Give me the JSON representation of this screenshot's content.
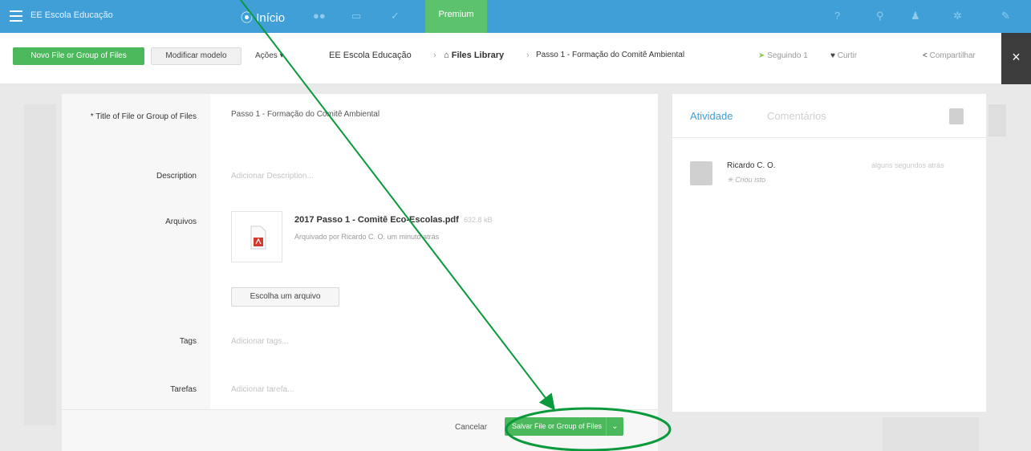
{
  "topbar": {
    "brand": "EE Escola Educação",
    "home": "Início",
    "premium": "Premium",
    "icons": [
      "users-icon",
      "calendar-icon",
      "tasks-icon",
      "help-icon",
      "search-icon",
      "user-icon",
      "add-user-icon",
      "tools-icon"
    ]
  },
  "actionbar": {
    "new_button": "Novo File or Group of Files",
    "modify_button": "Modificar modelo",
    "actions": "Ações",
    "breadcrumb": [
      "EE Escola Educação",
      "Files Library",
      "Passo 1 - Formação do Comitê Ambiental"
    ],
    "follow": "Seguindo",
    "follow_count": "1",
    "like": "Curtir",
    "share": "Compartilhar"
  },
  "form": {
    "title_label": "* Title of File or Group of Files",
    "title_value": "Passo 1 - Formação do Comitê Ambiental",
    "description_label": "Description",
    "description_placeholder": "Adicionar Description...",
    "files_label": "Arquivos",
    "file_name": "2017 Passo 1 - Comitê Eco-Escolas.pdf",
    "file_size": "632.8 kB",
    "file_meta": "Arquivado por Ricardo C. O. um minuto atrás",
    "choose_file": "Escolha um arquivo",
    "tags_label": "Tags",
    "tags_placeholder": "Adicionar tags...",
    "tasks_label": "Tarefas",
    "tasks_placeholder": "Adicionar tarefa..."
  },
  "footer": {
    "cancel": "Cancelar",
    "save": "Salvar File or Group of Files"
  },
  "activity": {
    "tab_active": "Atividade",
    "tab_other": "Comentários",
    "entries": [
      {
        "name": "Ricardo C. O.",
        "action": "Criou isto",
        "time": "alguns segundos atrás"
      }
    ]
  },
  "colors": {
    "topbar": "#3f9fd6",
    "green": "#4cb85c",
    "annotation": "#0a9a3c"
  }
}
